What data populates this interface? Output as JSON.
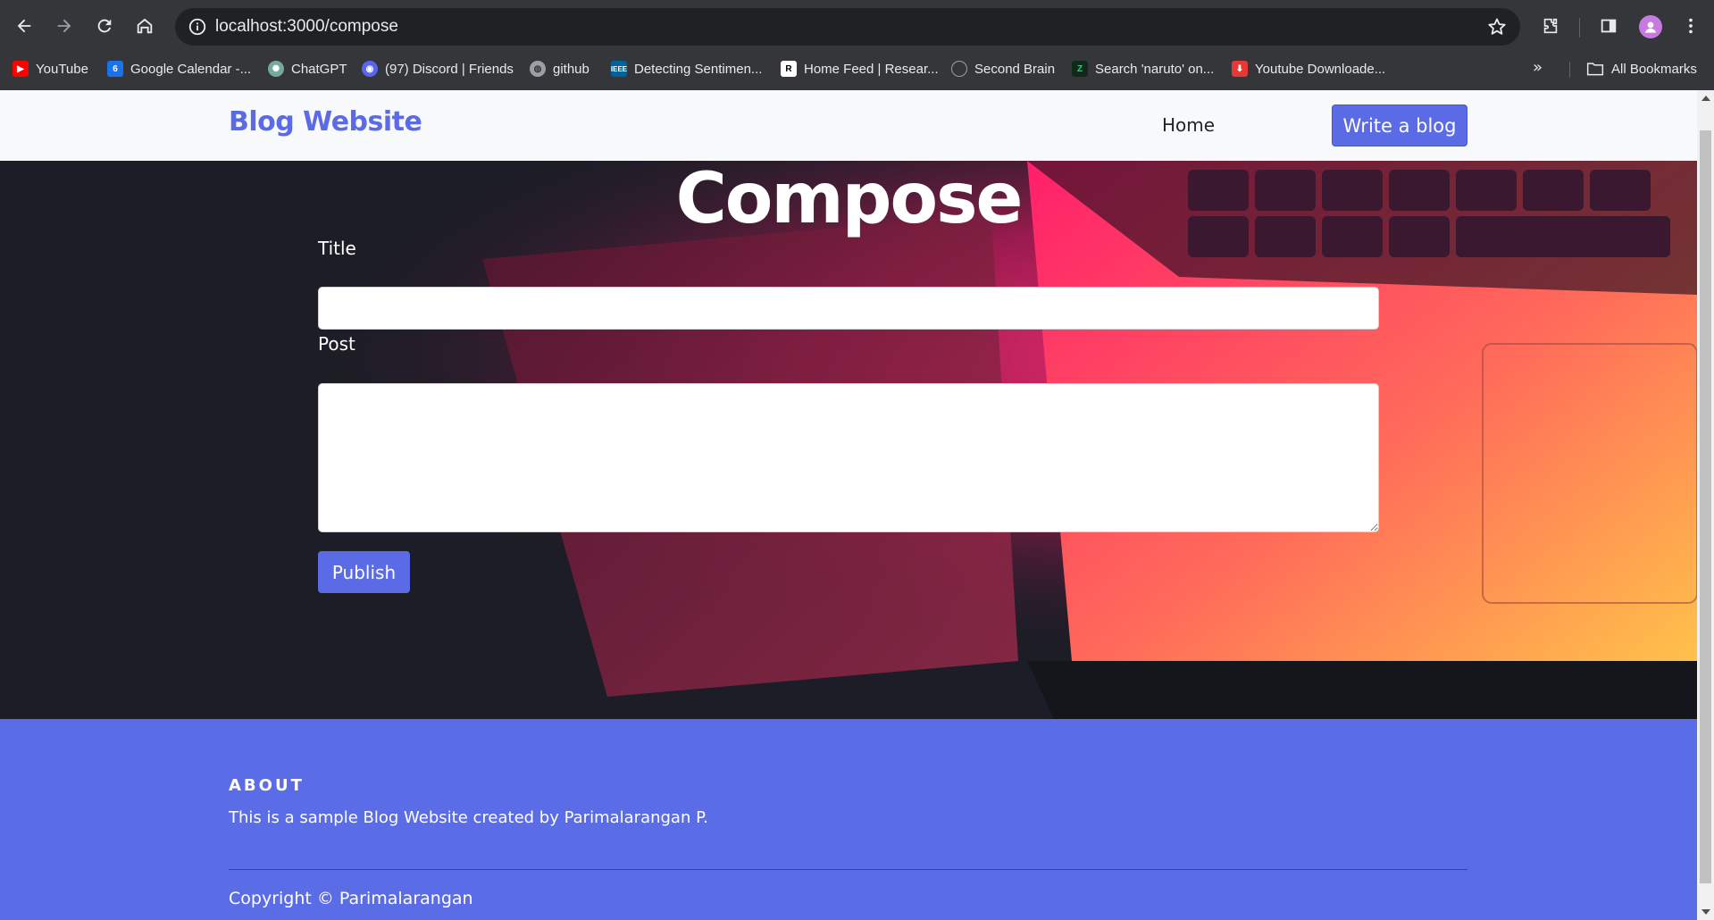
{
  "browser": {
    "url": "localhost:3000/compose",
    "bookmarks": [
      {
        "label": "YouTube",
        "icon": "youtube-icon",
        "color": "#ff0000"
      },
      {
        "label": "Google Calendar -...",
        "icon": "google-calendar-icon",
        "color": "#1a73e8"
      },
      {
        "label": "ChatGPT",
        "icon": "chatgpt-icon",
        "color": "#74aa9c"
      },
      {
        "label": "(97) Discord | Friends",
        "icon": "discord-icon",
        "color": "#5865f2"
      },
      {
        "label": "github",
        "icon": "globe-icon",
        "color": "#9aa0a6"
      },
      {
        "label": "Detecting Sentimen...",
        "icon": "ieee-icon",
        "color": "#00629b"
      },
      {
        "label": "Home Feed | Resear...",
        "icon": "researchgate-icon",
        "color": "#ffffff"
      },
      {
        "label": "Second Brain",
        "icon": "brain-icon",
        "color": "#9aa0a6"
      },
      {
        "label": "Search 'naruto' on...",
        "icon": "z-lightning-icon",
        "color": "#00c853"
      },
      {
        "label": "Youtube Downloade...",
        "icon": "download-icon",
        "color": "#e53935"
      }
    ],
    "all_bookmarks": "All Bookmarks"
  },
  "nav": {
    "brand": "Blog Website",
    "home": "Home",
    "write": "Write a blog"
  },
  "compose": {
    "heading": "Compose",
    "title_label": "Title",
    "title_value": "",
    "post_label": "Post",
    "post_value": "",
    "publish": "Publish"
  },
  "footer": {
    "about_heading": "ABOUT",
    "about_text": "This is a sample Blog Website created by Parimalarangan P.",
    "copyright": "Copyright © Parimalarangan"
  },
  "colors": {
    "accent": "#5b6be6",
    "footer_bg": "#5a6de6",
    "chrome_bg": "#35363a"
  }
}
